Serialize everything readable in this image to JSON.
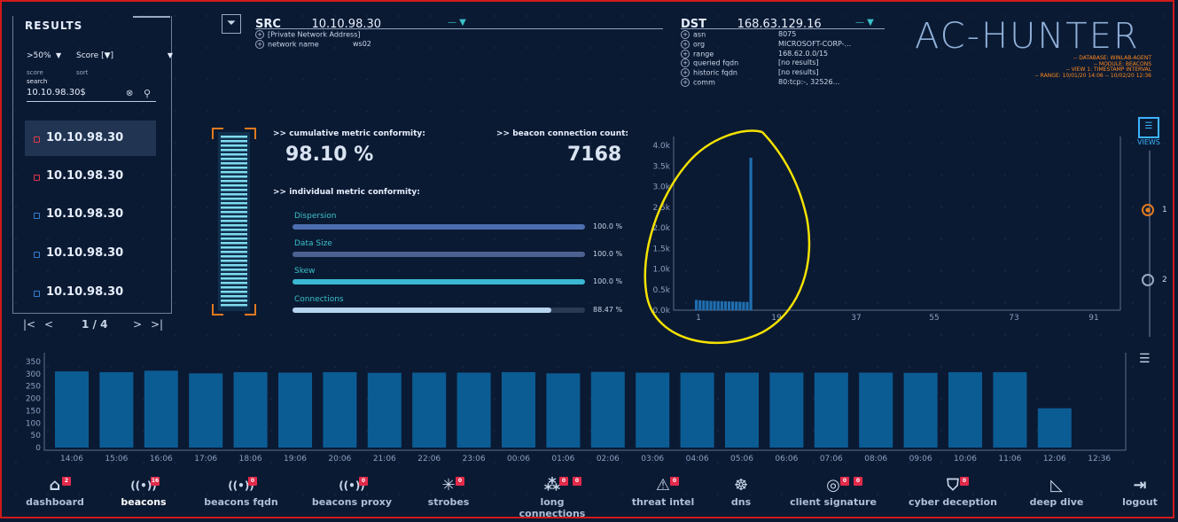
{
  "results": {
    "title": "RESULTS",
    "filter_threshold": ">50%",
    "filter_sort": "Score [▼]",
    "label_score": "score",
    "label_sort": "sort",
    "label_search": "search",
    "search_value": "10.10.98.30$",
    "items": [
      {
        "ip": "10.10.98.30",
        "color": "#e2364a"
      },
      {
        "ip": "10.10.98.30",
        "color": "#e2364a"
      },
      {
        "ip": "10.10.98.30",
        "color": "#2f7fd1"
      },
      {
        "ip": "10.10.98.30",
        "color": "#2f7fd1"
      },
      {
        "ip": "10.10.98.30",
        "color": "#2f7fd1"
      }
    ],
    "page": "1 / 4"
  },
  "src": {
    "label": "SRC",
    "ip": "10.10.98.30",
    "private_note": "[Private Network Address]",
    "network_name_label": "network name",
    "network_name_value": "ws02"
  },
  "dst": {
    "label": "DST",
    "ip": "168.63.129.16",
    "rows": [
      {
        "k": "asn",
        "v": "8075"
      },
      {
        "k": "org",
        "v": "MICROSOFT-CORP-..."
      },
      {
        "k": "range",
        "v": "168.62.0.0/15"
      },
      {
        "k": "queried fqdn",
        "v": "[no results]"
      },
      {
        "k": "historic fqdn",
        "v": "[no results]"
      },
      {
        "k": "comm",
        "v": "80:tcp:-, 32526..."
      }
    ]
  },
  "brand": {
    "name": "AC-HUNTER",
    "meta": [
      "-- DATABASE: WINLAB-AGENT",
      "-- MODULE: BEACONS",
      "-- VIEW 1: TIMESTAMP INTERVAL",
      "-- RANGE: 10/01/20 14:06 -- 10/02/20 12:36"
    ]
  },
  "metrics": {
    "cumulative_label": ">> cumulative metric conformity:",
    "cumulative_value": "98.10 %",
    "count_label": ">> beacon connection count:",
    "count_value": "7168",
    "individual_label": ">> individual metric conformity:",
    "bars": [
      {
        "name": "Dispersion",
        "pct_text": "100.0 %",
        "pct": 100,
        "color": "#4d6fb0"
      },
      {
        "name": "Data Size",
        "pct_text": "100.0 %",
        "pct": 100,
        "color": "#4d6190"
      },
      {
        "name": "Skew",
        "pct_text": "100.0 %",
        "pct": 100,
        "color": "#3ab8d4"
      },
      {
        "name": "Connections",
        "pct_text": "88.47 %",
        "pct": 88.47,
        "color": "#b7d4ef"
      }
    ]
  },
  "views": {
    "label": "VIEWS",
    "options": [
      "1",
      "2"
    ]
  },
  "chart_data": [
    {
      "type": "bar",
      "ylim": [
        0,
        4000
      ],
      "yticks": [
        "0.0k",
        "0.5k",
        "1.0k",
        "1.5k",
        "2.0k",
        "2.5k",
        "3.0k",
        "3.5k",
        "4.0k"
      ],
      "xticks": [
        "1",
        "19",
        "37",
        "55",
        "73",
        "91"
      ],
      "x": [
        1,
        2,
        3,
        4,
        5,
        6,
        7,
        8,
        9,
        10,
        11,
        12,
        13,
        14,
        15,
        16
      ],
      "values": [
        250,
        240,
        235,
        230,
        225,
        222,
        220,
        218,
        215,
        212,
        210,
        208,
        205,
        200,
        200,
        3700
      ]
    },
    {
      "type": "bar",
      "ylim": [
        0,
        350
      ],
      "yticks": [
        "0",
        "50",
        "100",
        "150",
        "200",
        "250",
        "300",
        "350"
      ],
      "categories": [
        "14:06",
        "15:06",
        "16:06",
        "17:06",
        "18:06",
        "19:06",
        "20:06",
        "21:06",
        "22:06",
        "23:06",
        "00:06",
        "01:06",
        "02:06",
        "03:06",
        "04:06",
        "05:06",
        "06:06",
        "07:06",
        "08:06",
        "09:06",
        "10:06",
        "11:06",
        "12:06",
        "12:36"
      ],
      "values": [
        310,
        307,
        313,
        302,
        307,
        305,
        307,
        304,
        305,
        305,
        307,
        302,
        308,
        305,
        305,
        305,
        305,
        305,
        305,
        304,
        307,
        307,
        160
      ]
    }
  ],
  "nav": [
    {
      "label": "dashboard",
      "icon": "home-icon",
      "glyph": "⌂",
      "badges": [
        "2"
      ]
    },
    {
      "label": "beacons",
      "icon": "beacon-icon",
      "glyph": "((•))",
      "badges": [
        "16"
      ],
      "active": true
    },
    {
      "label": "beacons fqdn",
      "icon": "beacon-icon",
      "glyph": "((•))",
      "badges": [
        "0"
      ]
    },
    {
      "label": "beacons proxy",
      "icon": "beacon-icon",
      "glyph": "((•))",
      "badges": [
        "0"
      ]
    },
    {
      "label": "strobes",
      "icon": "strobe-icon",
      "glyph": "✳",
      "badges": [
        "0"
      ]
    },
    {
      "label": "long connections",
      "icon": "network-icon",
      "glyph": "⁂",
      "badges": [
        "0",
        "0"
      ]
    },
    {
      "label": "threat intel",
      "icon": "warning-icon",
      "glyph": "⚠",
      "badges": [
        "0"
      ]
    },
    {
      "label": "dns",
      "icon": "ship-wheel-icon",
      "glyph": "☸",
      "badges": []
    },
    {
      "label": "client signature",
      "icon": "fingerprint-icon",
      "glyph": "◎",
      "badges": [
        "0",
        "0"
      ]
    },
    {
      "label": "cyber deception",
      "icon": "shield-icon",
      "glyph": "⛉",
      "badges": [
        "0"
      ]
    },
    {
      "label": "deep dive",
      "icon": "shark-fin-icon",
      "glyph": "◺",
      "badges": []
    },
    {
      "label": "logout",
      "icon": "logout-icon",
      "glyph": "⇥",
      "badges": []
    }
  ]
}
